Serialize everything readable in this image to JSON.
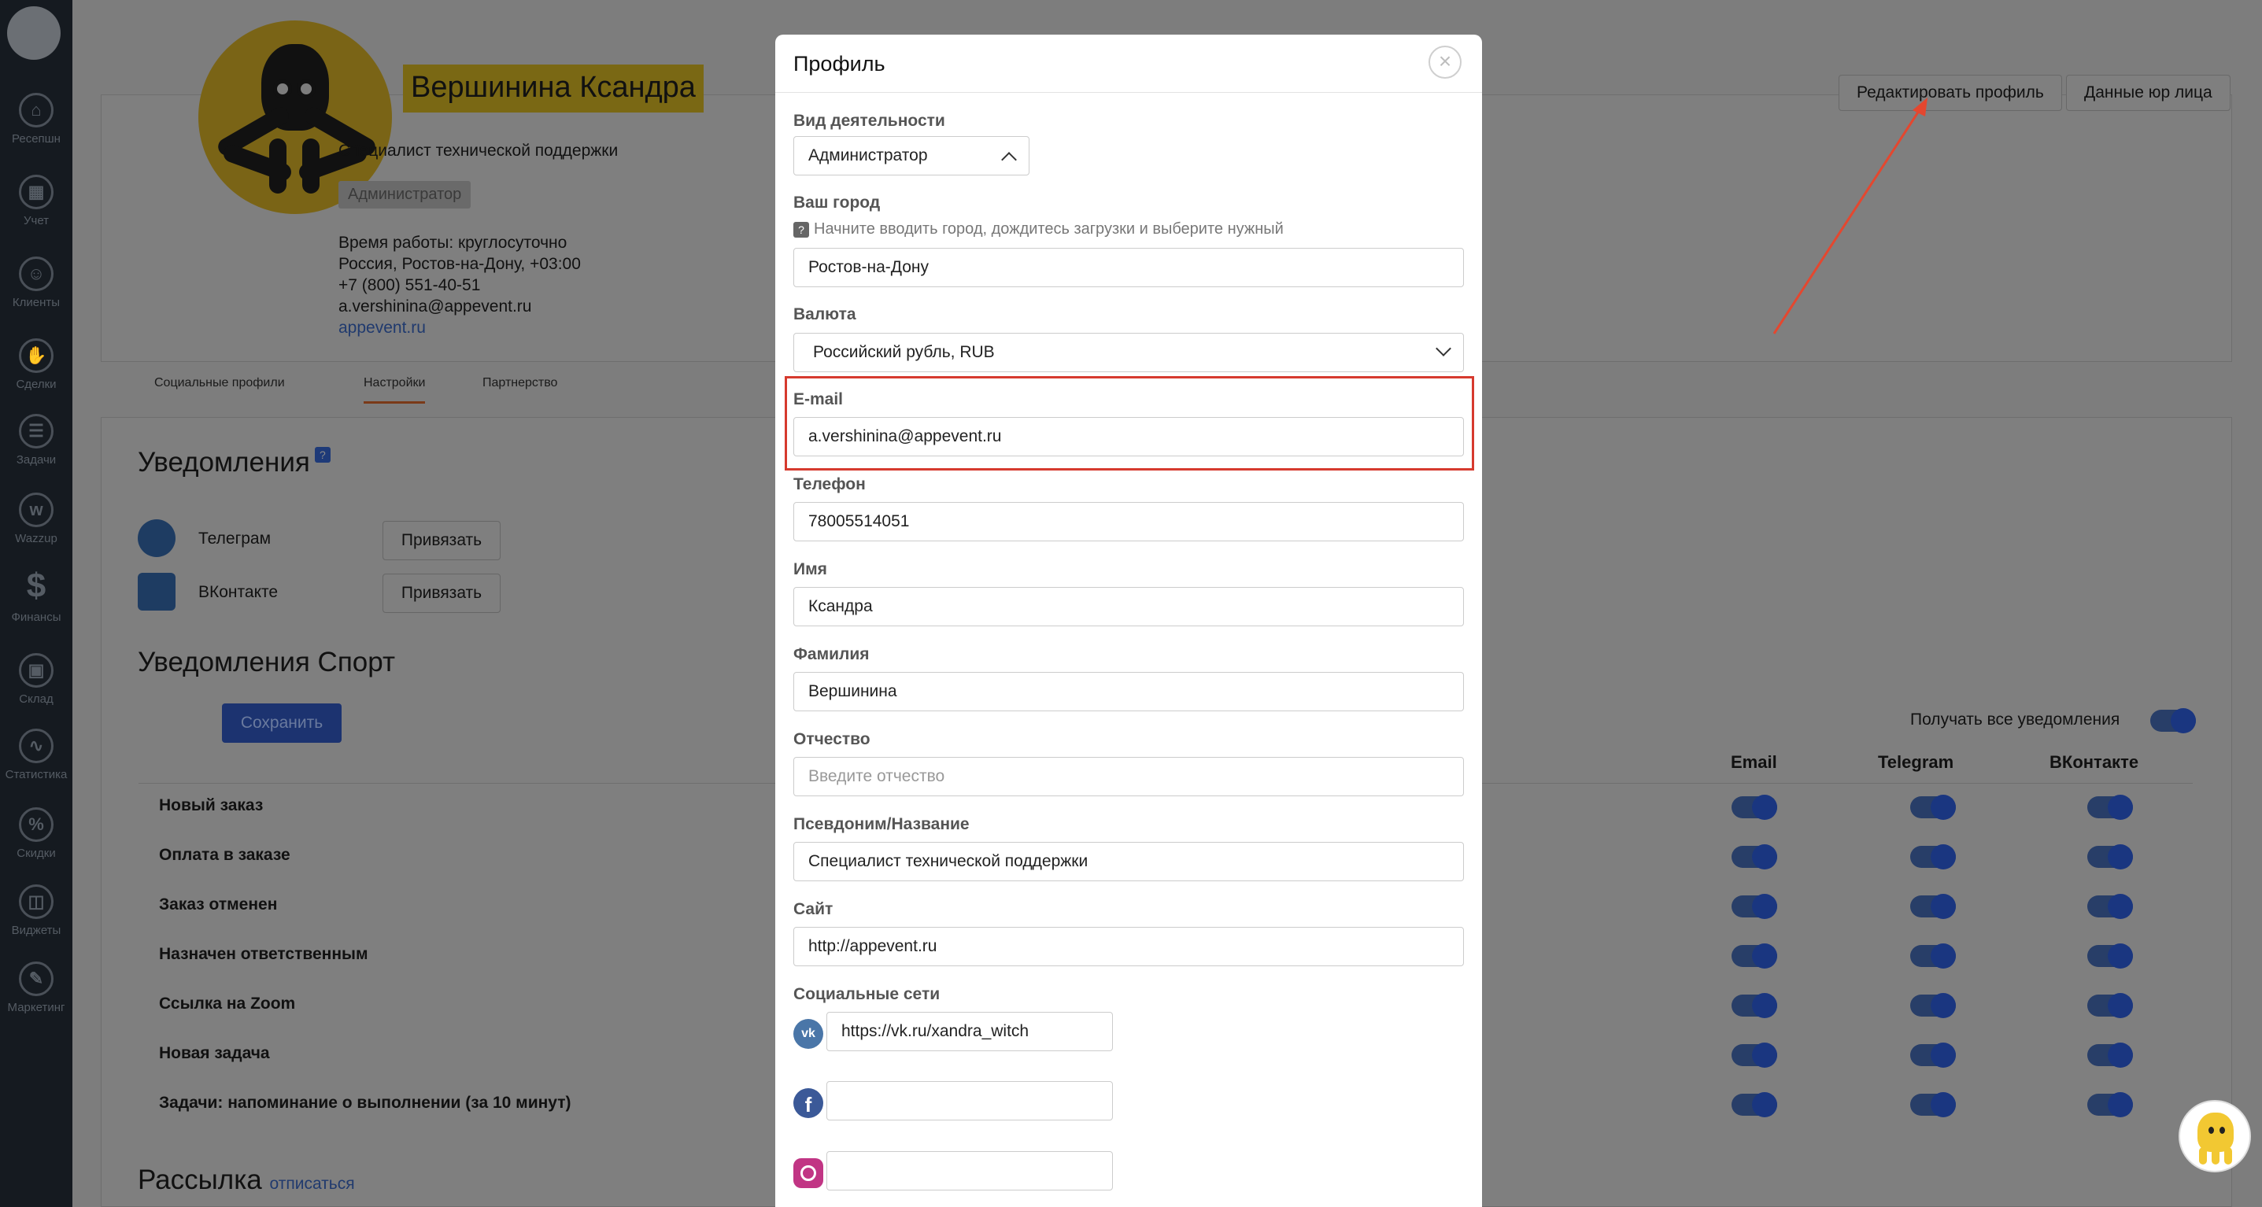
{
  "sidebar": {
    "items": [
      {
        "label": "Ресепшн",
        "icon": "home-icon"
      },
      {
        "label": "Учет",
        "icon": "calendar-icon"
      },
      {
        "label": "Клиенты",
        "icon": "user-icon"
      },
      {
        "label": "Сделки",
        "icon": "handshake-icon"
      },
      {
        "label": "Задачи",
        "icon": "tasks-icon"
      },
      {
        "label": "Wazzup",
        "icon": "wazzup-icon"
      },
      {
        "label": "Финансы",
        "icon": "dollar-icon"
      },
      {
        "label": "Склад",
        "icon": "box-icon"
      },
      {
        "label": "Статистика",
        "icon": "chart-icon"
      },
      {
        "label": "Скидки",
        "icon": "tag-icon"
      },
      {
        "label": "Виджеты",
        "icon": "widgets-icon"
      },
      {
        "label": "Маркетинг",
        "icon": "marketing-icon"
      }
    ]
  },
  "profile": {
    "name": "Вершинина Ксандра",
    "position": "Специалист технической поддержки",
    "role_badge": "Администратор",
    "work_time": "Время работы: круглосуточно",
    "location": "Россия, Ростов-на-Дону, +03:00",
    "phone": "+7 (800) 551-40-51",
    "email": "a.vershinina@appevent.ru",
    "site": "appevent.ru",
    "edit_button": "Редактировать профиль",
    "legal_button": "Данные юр лица"
  },
  "tabs": [
    "Социальные профили",
    "Настройки",
    "Партнерство"
  ],
  "notifications": {
    "title": "Уведомления",
    "help": "?",
    "telegram_label": "Телеграм",
    "vk_label": "ВКонтакте",
    "bind_label": "Привязать"
  },
  "sport": {
    "title": "Уведомления Спорт",
    "save_label": "Сохранить",
    "receive_all": "Получать все уведомления",
    "columns": [
      "Email",
      "Telegram",
      "ВКонтакте"
    ],
    "rows": [
      "Новый заказ",
      "Оплата в заказе",
      "Заказ отменен",
      "Назначен ответственным",
      "Ссылка на Zoom",
      "Новая задача",
      "Задачи: напоминание о выполнении (за 10 минут)"
    ]
  },
  "mailing": {
    "title": "Рассылка",
    "unsubscribe": "отписаться"
  },
  "modal": {
    "title": "Профиль",
    "close": "×",
    "activity_label": "Вид деятельности",
    "activity_value": "Администратор",
    "city_label": "Ваш город",
    "city_hint": "Начните вводить город, дождитесь загрузки и выберите нужный",
    "city_value": "Ростов-на-Дону",
    "currency_label": "Валюта",
    "currency_value": "Российский рубль, RUB",
    "email_label": "E-mail",
    "email_value": "a.vershinina@appevent.ru",
    "phone_label": "Телефон",
    "phone_value": "78005514051",
    "first_name_label": "Имя",
    "first_name_value": "Ксандра",
    "last_name_label": "Фамилия",
    "last_name_value": "Вершинина",
    "middle_name_label": "Отчество",
    "middle_name_placeholder": "Введите отчество",
    "alias_label": "Псевдоним/Название",
    "alias_value": "Специалист технической поддержки",
    "site_label": "Сайт",
    "site_value": "http://appevent.ru",
    "social_label": "Социальные сети",
    "vk_value": "https://vk.ru/xandra_witch",
    "facebook_value": "",
    "instagram_value": ""
  },
  "colors": {
    "highlight": "#d63a2e",
    "arrow": "#e4472f",
    "accent": "#1c3370"
  }
}
